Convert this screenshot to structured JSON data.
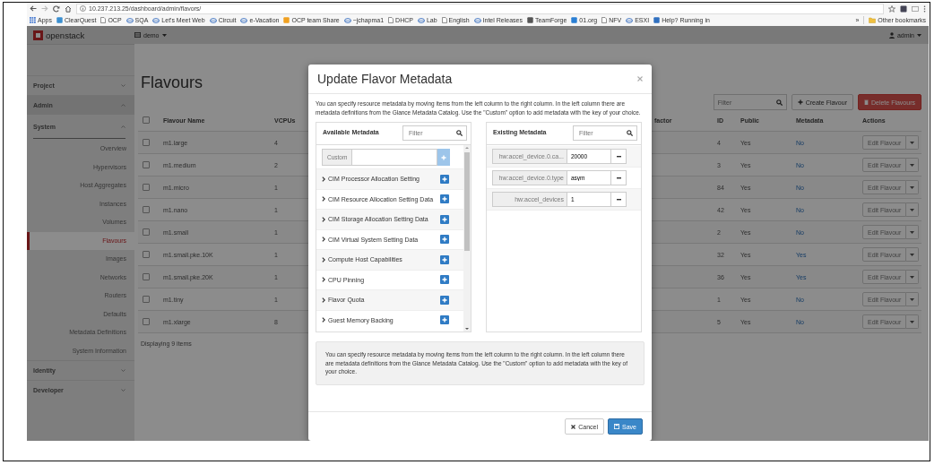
{
  "browser": {
    "url": "10.237.213.25/dashboard/admin/flavors/",
    "bookmarks": [
      {
        "label": "Apps",
        "kind": "grid"
      },
      {
        "label": "ClearQuest",
        "kind": "app",
        "color": "#3b8fd0"
      },
      {
        "label": "OCP",
        "kind": "page"
      },
      {
        "label": "SQA",
        "kind": "web"
      },
      {
        "label": "Let's Meet Web",
        "kind": "web"
      },
      {
        "label": "Circuit",
        "kind": "web"
      },
      {
        "label": "e-Vacation",
        "kind": "web"
      },
      {
        "label": "OCP team Share",
        "kind": "app",
        "color": "#f0a020"
      },
      {
        "label": "~jchapma1",
        "kind": "web"
      },
      {
        "label": "DHCP",
        "kind": "page"
      },
      {
        "label": "Lab",
        "kind": "web"
      },
      {
        "label": "English",
        "kind": "page"
      },
      {
        "label": "Intel Releases",
        "kind": "web"
      },
      {
        "label": "TeamForge",
        "kind": "app",
        "color": "#555555"
      },
      {
        "label": "01.org",
        "kind": "app",
        "color": "#2a7fd4"
      },
      {
        "label": "NFV",
        "kind": "page"
      },
      {
        "label": "ESXI",
        "kind": "web"
      },
      {
        "label": "Help? Running in",
        "kind": "app",
        "color": "#3070c0"
      }
    ],
    "overflow": "»",
    "other_bookmarks": "Other bookmarks"
  },
  "header": {
    "logo": "openstack",
    "project": "demo",
    "user": "admin"
  },
  "sidebar": [
    {
      "label": "Project",
      "expanded": false
    },
    {
      "label": "Admin",
      "expanded": true,
      "children": [
        {
          "label": "System",
          "expanded": true,
          "children": [
            {
              "label": "Overview",
              "selected": false
            },
            {
              "label": "Hypervisors",
              "selected": false
            },
            {
              "label": "Host Aggregates",
              "selected": false
            },
            {
              "label": "Instances",
              "selected": false
            },
            {
              "label": "Volumes",
              "selected": false
            },
            {
              "label": "Flavours",
              "selected": true
            },
            {
              "label": "Images",
              "selected": false
            },
            {
              "label": "Networks",
              "selected": false
            },
            {
              "label": "Routers",
              "selected": false
            },
            {
              "label": "Defaults",
              "selected": false
            },
            {
              "label": "Metadata Definitions",
              "selected": false
            },
            {
              "label": "System Information",
              "selected": false
            }
          ]
        }
      ]
    },
    {
      "label": "Identity",
      "expanded": false
    },
    {
      "label": "Developer",
      "expanded": false
    }
  ],
  "page": {
    "title": "Flavours",
    "filter_placeholder": "Filter",
    "create_button": "Create Flavour",
    "delete_button": "Delete Flavours"
  },
  "table": {
    "columns": [
      "Flavour Name",
      "VCPUs",
      "factor",
      "ID",
      "Public",
      "Metadata",
      "Actions"
    ],
    "select_all_checked": false,
    "rows": [
      {
        "checked": false,
        "name": "m1.large",
        "vcpus": "4",
        "id": "4",
        "public": "Yes",
        "metadata": "No",
        "action": "Edit Flavour"
      },
      {
        "checked": false,
        "name": "m1.medium",
        "vcpus": "2",
        "id": "3",
        "public": "Yes",
        "metadata": "No",
        "action": "Edit Flavour"
      },
      {
        "checked": false,
        "name": "m1.micro",
        "vcpus": "1",
        "id": "84",
        "public": "Yes",
        "metadata": "No",
        "action": "Edit Flavour"
      },
      {
        "checked": false,
        "name": "m1.nano",
        "vcpus": "1",
        "id": "42",
        "public": "Yes",
        "metadata": "No",
        "action": "Edit Flavour"
      },
      {
        "checked": false,
        "name": "m1.small",
        "vcpus": "1",
        "id": "2",
        "public": "Yes",
        "metadata": "No",
        "action": "Edit Flavour"
      },
      {
        "checked": false,
        "name": "m1.small.pke.10K",
        "vcpus": "1",
        "id": "32",
        "public": "Yes",
        "metadata": "Yes",
        "action": "Edit Flavour"
      },
      {
        "checked": false,
        "name": "m1.small.pke.20K",
        "vcpus": "1",
        "id": "36",
        "public": "Yes",
        "metadata": "Yes",
        "action": "Edit Flavour"
      },
      {
        "checked": false,
        "name": "m1.tiny",
        "vcpus": "1",
        "id": "1",
        "public": "Yes",
        "metadata": "No",
        "action": "Edit Flavour"
      },
      {
        "checked": false,
        "name": "m1.xlarge",
        "vcpus": "8",
        "id": "5",
        "public": "Yes",
        "metadata": "No",
        "action": "Edit Flavour"
      }
    ],
    "footer": "Displaying 9 items"
  },
  "modal": {
    "title": "Update Flavor Metadata",
    "description": "You can specify resource metadata by moving items from the left column to the right column. In the left column there are metadata definitions from the Glance Metadata Catalog. Use the \"Custom\" option to add metadata with the key of your choice.",
    "available": {
      "title": "Available Metadata",
      "filter_placeholder": "Filter",
      "custom_label": "Custom",
      "items": [
        "CIM Processor Allocation Setting",
        "CIM Resource Allocation Setting Data",
        "CIM Storage Allocation Setting Data",
        "CIM Virtual System Setting Data",
        "Compute Host Capabilities",
        "CPU Pinning",
        "Flavor Quota",
        "Guest Memory Backing"
      ]
    },
    "existing": {
      "title": "Existing Metadata",
      "filter_placeholder": "Filter",
      "items": [
        {
          "key": "hw:accel_device.0.ca...",
          "value": "20000"
        },
        {
          "key": "hw:accel_device.0.type",
          "value": "asym"
        },
        {
          "key": "hw:accel_devices",
          "value": "1"
        }
      ]
    },
    "help": "You can specify resource metadata by moving items from the left column to the right column. In the left column there are metadata definitions from the Glance Metadata Catalog. Use the \"Custom\" option to add metadata with the key of your choice.",
    "cancel": "Cancel",
    "save": "Save"
  }
}
